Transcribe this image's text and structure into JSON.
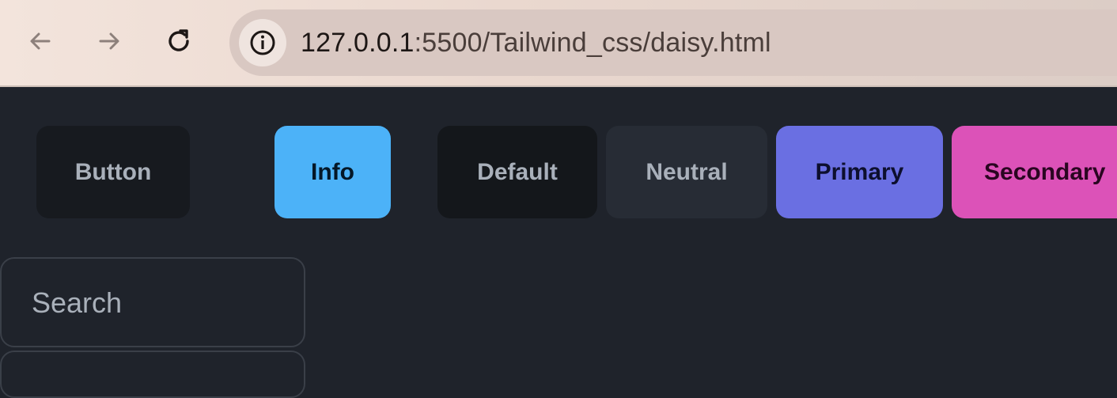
{
  "browser": {
    "url_host": "127.0.0.1",
    "url_rest": ":5500/Tailwind_css/daisy.html",
    "icons": {
      "back": "arrow-left-icon",
      "forward": "arrow-right-icon",
      "reload": "reload-icon",
      "site_info": "info-circle-icon"
    }
  },
  "buttons": [
    {
      "label": "Button",
      "color": "#171a1f"
    },
    {
      "label": "Info",
      "color": "#4cb2f8"
    },
    {
      "label": "Default",
      "color": "#14171b"
    },
    {
      "label": "Neutral",
      "color": "#272c35"
    },
    {
      "label": "Primary",
      "color": "#6a6fe2"
    },
    {
      "label": "Secondary",
      "color": "#dc52b8"
    }
  ],
  "search": {
    "placeholder": "Search",
    "value": ""
  }
}
